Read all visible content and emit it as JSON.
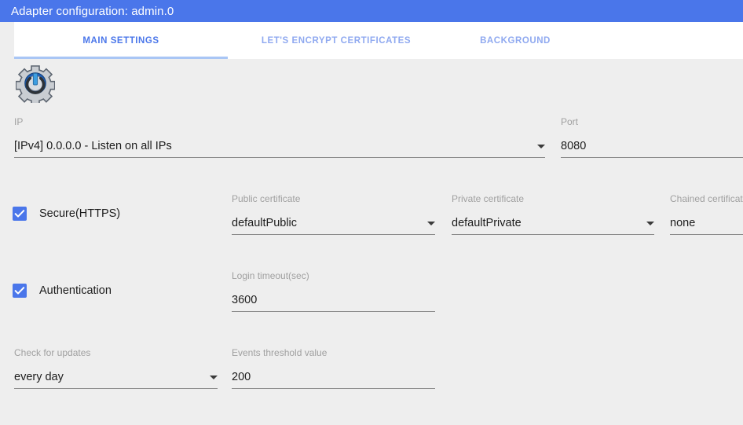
{
  "window": {
    "title": "Adapter configuration: admin.0",
    "title_bar_color": "#4a76ea"
  },
  "tabs": [
    {
      "label": "MAIN SETTINGS",
      "active": true
    },
    {
      "label": "LET'S ENCRYPT CERTIFICATES",
      "active": false
    },
    {
      "label": "BACKGROUND",
      "active": false
    }
  ],
  "icons": {
    "adapter": "gear-settings-icon",
    "dropdown": "chevron-down-icon",
    "checkmark": "check-icon"
  },
  "colors": {
    "accent": "#4a76ea",
    "tab_inactive": "#8fa9f0",
    "tab_indicator": "#a9c6f5",
    "page_background": "#eeeeee",
    "label": "#a0a0a0",
    "value": "#1c1c1c",
    "underline": "#8c8c8c"
  },
  "form": {
    "ip": {
      "label": "IP",
      "value": "[IPv4] 0.0.0.0 - Listen on all IPs",
      "type": "select"
    },
    "port": {
      "label": "Port",
      "value": "8080",
      "type": "text"
    },
    "secure_https": {
      "label": "Secure(HTTPS)",
      "checked": true,
      "type": "checkbox"
    },
    "public_certificate": {
      "label": "Public certificate",
      "value": "defaultPublic",
      "type": "select"
    },
    "private_certificate": {
      "label": "Private certificate",
      "value": "defaultPrivate",
      "type": "select"
    },
    "chained_certificate": {
      "label": "Chained certificate",
      "value": "none",
      "type": "select"
    },
    "authentication": {
      "label": "Authentication",
      "checked": true,
      "type": "checkbox"
    },
    "login_timeout": {
      "label": "Login timeout(sec)",
      "value": "3600",
      "type": "text"
    },
    "check_for_updates": {
      "label": "Check for updates",
      "value": "every day",
      "type": "select"
    },
    "events_threshold": {
      "label": "Events threshold value",
      "value": "200",
      "type": "text"
    }
  }
}
